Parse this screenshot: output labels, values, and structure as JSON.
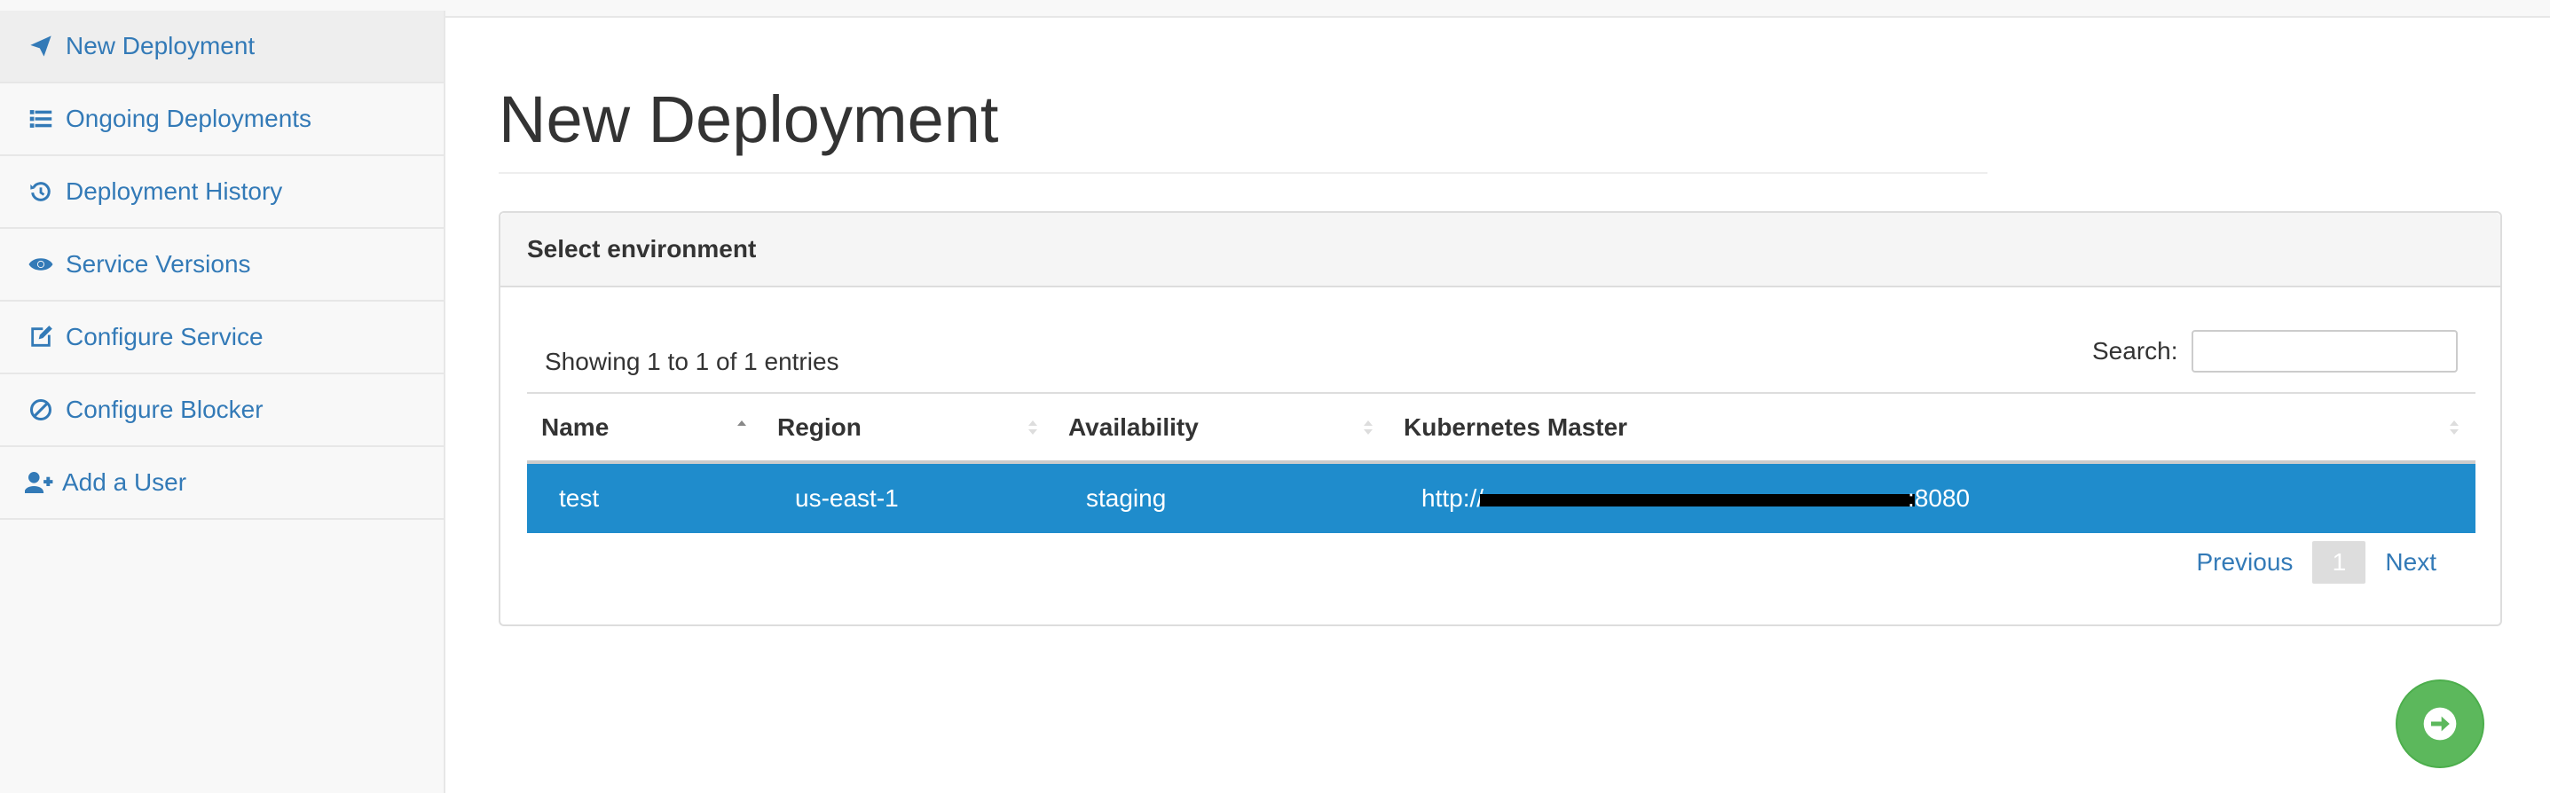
{
  "sidebar": {
    "items": [
      {
        "label": "New Deployment",
        "icon": "paper-plane-icon",
        "active": true
      },
      {
        "label": "Ongoing Deployments",
        "icon": "list-icon"
      },
      {
        "label": "Deployment History",
        "icon": "history-icon"
      },
      {
        "label": "Service Versions",
        "icon": "eye-icon"
      },
      {
        "label": "Configure Service",
        "icon": "edit-icon"
      },
      {
        "label": "Configure Blocker",
        "icon": "ban-icon"
      },
      {
        "label": "Add a User",
        "icon": "user-plus-icon"
      }
    ]
  },
  "main": {
    "title": "New Deployment",
    "panel": {
      "heading": "Select environment",
      "info": "Showing 1 to 1 of 1 entries",
      "search_label": "Search:",
      "search_value": "",
      "columns": [
        "Name",
        "Region",
        "Availability",
        "Kubernetes Master"
      ],
      "rows": [
        {
          "name": "test",
          "region": "us-east-1",
          "availability": "staging",
          "master_prefix": "http://",
          "master_suffix": ":8080"
        }
      ],
      "pagination": {
        "previous": "Previous",
        "current": "1",
        "next": "Next"
      }
    },
    "next_button_icon": "arrow-right-icon"
  },
  "colors": {
    "link": "#337ab7",
    "selected_row": "#1f8ccc",
    "fab": "#5cb85c"
  }
}
